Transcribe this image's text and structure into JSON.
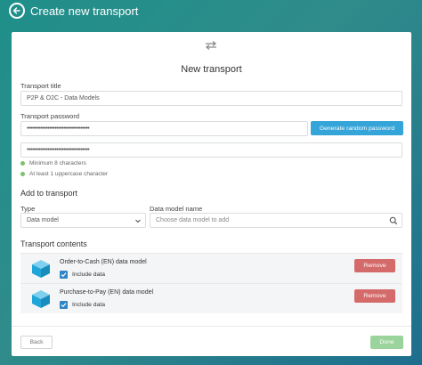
{
  "header": {
    "title": "Create new transport",
    "back_icon": "back-arrow-icon"
  },
  "card": {
    "title": "New transport",
    "icon": "transfer-arrows-icon"
  },
  "form": {
    "title_label": "Transport title",
    "title_value": "P2P & O2C - Data Models",
    "password_label": "Transport password",
    "password_value": "••••••••••••••••••••••••••••••••••••",
    "password_confirm_value": "••••••••••••••••••••••••••••••••••••",
    "generate_button": "Generate random password",
    "hints": [
      "Minimum 8 characters",
      "At least 1 uppercase character"
    ]
  },
  "add": {
    "title": "Add to transport",
    "type_label": "Type",
    "type_value": "Data model",
    "model_label": "Data model name",
    "model_placeholder": "Choose data model to add"
  },
  "contents": {
    "title": "Transport contents",
    "items": [
      {
        "name": "Order-to-Cash (EN) data model",
        "include_label": "Include data",
        "remove_label": "Remove",
        "include_checked": true
      },
      {
        "name": "Purchase-to-Pay (EN) data model",
        "include_label": "Include data",
        "remove_label": "Remove",
        "include_checked": true
      }
    ]
  },
  "footer": {
    "back_label": "Back",
    "done_label": "Done"
  },
  "colors": {
    "accent": "#35a4d8",
    "remove": "#d46a6a",
    "done": "#9ad39c",
    "valid": "#7dc06b"
  }
}
